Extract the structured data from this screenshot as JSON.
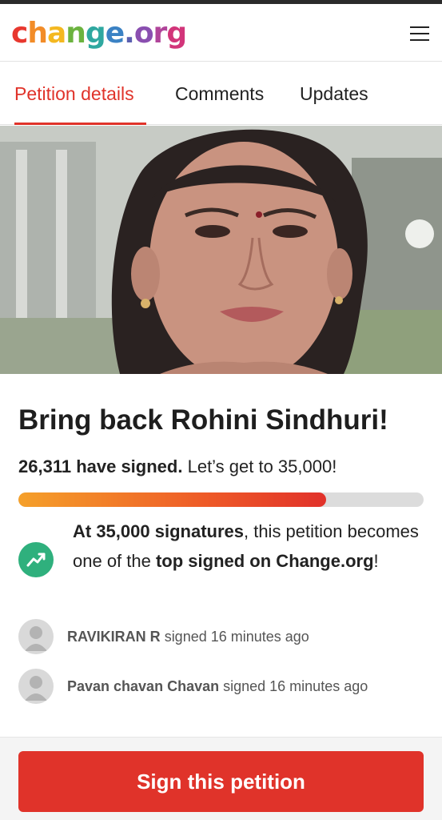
{
  "header": {
    "logo": [
      "c",
      "h",
      "a",
      "n",
      "g",
      "e",
      ".",
      "o",
      "r",
      "g"
    ],
    "logo_colors": [
      "#e8382f",
      "#f28c28",
      "#f4b820",
      "#6cb33f",
      "#2fa8a0",
      "#3b82c4",
      "#5b5fb0",
      "#8a4fb0",
      "#b0449a",
      "#d2357a"
    ]
  },
  "tabs": [
    {
      "label": "Petition details"
    },
    {
      "label": "Comments"
    },
    {
      "label": "Updates"
    }
  ],
  "petition": {
    "title": "Bring back Rohini Sindhuri!",
    "signed_count": "26,311 have signed.",
    "goal_text": "Let’s get to 35,000!",
    "progress_percent": 76
  },
  "milestone": {
    "part1": "At 35,000 signatures",
    "part2": ", this petition becomes one of the ",
    "part3": "top signed on Change.org",
    "part4": "!"
  },
  "signers": [
    {
      "name": "RAVIKIRAN R",
      "action": "signed 16 minutes ago"
    },
    {
      "name": "Pavan chavan Chavan",
      "action": "signed 16 minutes ago"
    }
  ],
  "cta": {
    "label": "Sign this petition"
  },
  "colors": {
    "accent": "#e0332a",
    "milestone": "#2fb07d"
  }
}
